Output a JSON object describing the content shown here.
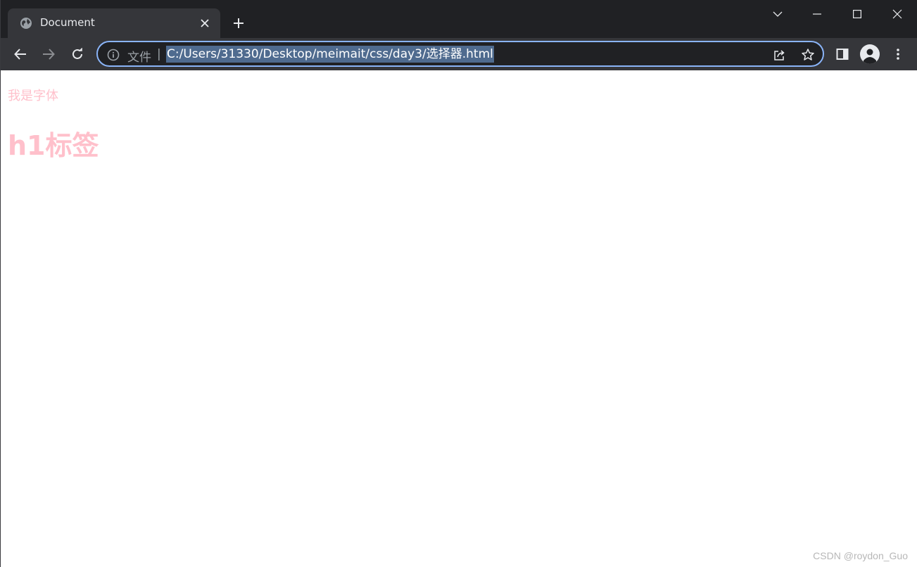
{
  "tab": {
    "title": "Document",
    "favicon": "globe-icon",
    "close_icon": "close-icon"
  },
  "tabstrip": {
    "new_tab_icon": "plus-icon",
    "tab_search_icon": "chevron-down-icon",
    "minimize_icon": "minimize-icon",
    "maximize_icon": "maximize-icon",
    "close_window_icon": "close-window-icon"
  },
  "toolbar": {
    "back_icon": "back-arrow-icon",
    "forward_icon": "forward-arrow-icon",
    "reload_icon": "reload-icon",
    "side_panel_icon": "side-panel-icon",
    "profile_icon": "profile-icon",
    "menu_icon": "kebab-menu-icon"
  },
  "omnibox": {
    "scheme_label": "文件",
    "separator": "|",
    "url": "C:/Users/31330/Desktop/meimait/css/day3/选择器.html",
    "share_icon": "share-icon",
    "bookmark_icon": "star-icon"
  },
  "page": {
    "font_text": "我是字体",
    "h1_text": "h1标签",
    "text_color": "#ffc0cb"
  },
  "watermark": "CSDN @roydon_Guo",
  "colors": {
    "tabstrip_bg": "#202124",
    "toolbar_bg": "#35363a",
    "omnibox_focus": "#8ab4f8",
    "url_selection": "#4f6b8f"
  }
}
